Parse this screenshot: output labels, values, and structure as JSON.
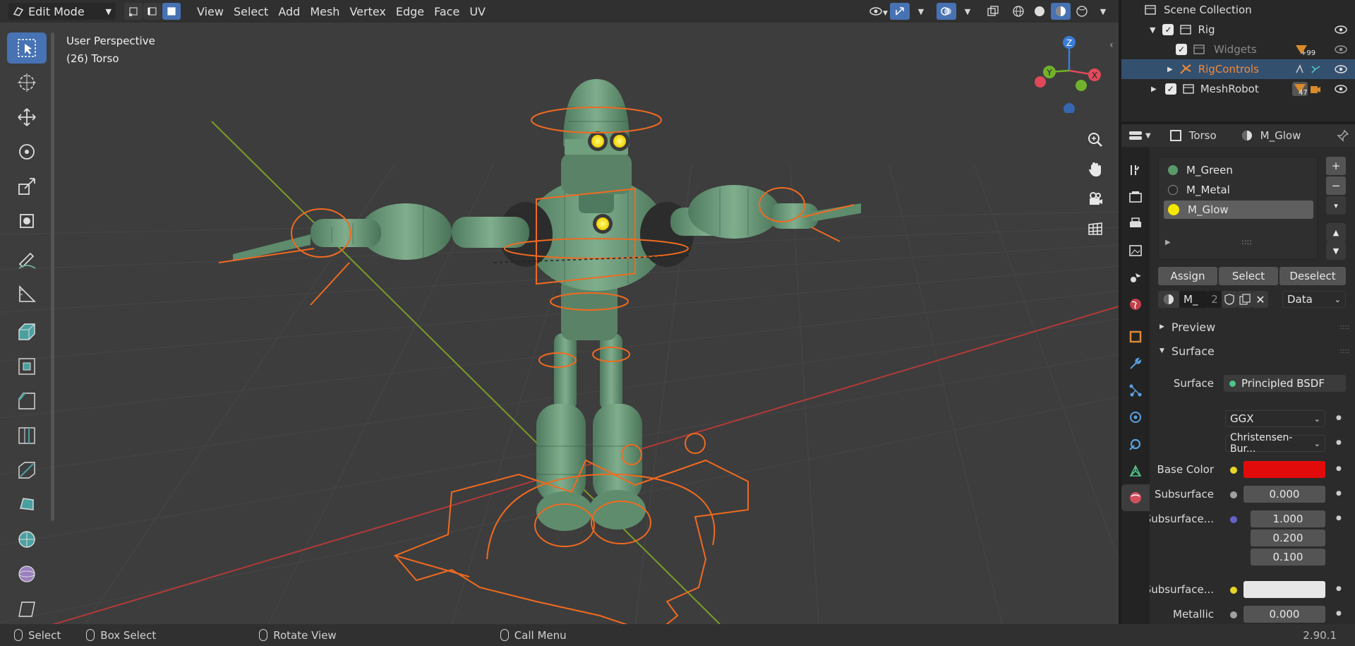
{
  "header": {
    "mode": "Edit Mode",
    "menus": [
      "View",
      "Select",
      "Add",
      "Mesh",
      "Vertex",
      "Edge",
      "Face",
      "UV"
    ]
  },
  "viewport": {
    "perspective": "User Perspective",
    "object": "(26) Torso",
    "gizmo_axes": {
      "x": "X",
      "y": "Y",
      "z": "Z"
    }
  },
  "outliner": {
    "scene_collection": "Scene Collection",
    "items": [
      {
        "name": "Rig",
        "badge": ""
      },
      {
        "name": "Widgets",
        "badge": "+99"
      },
      {
        "name": "RigControls",
        "badge": ""
      },
      {
        "name": "MeshRobot",
        "badge": "47"
      }
    ]
  },
  "properties": {
    "object_name": "Torso",
    "material_name": "M_Glow",
    "slots": [
      "M_Green",
      "M_Metal",
      "M_Glow"
    ],
    "assign": "Assign",
    "select": "Select",
    "deselect": "Deselect",
    "mat_field": "M_",
    "users": "2",
    "link": "Data",
    "preview": "Preview",
    "surface_panel": "Surface",
    "surface_label": "Surface",
    "surface_value": "Principled BSDF",
    "distribution": "GGX",
    "subsurface_method": "Christensen-Bur...",
    "base_color_label": "Base Color",
    "subsurface_label": "Subsurface",
    "subsurface_value": "0.000",
    "subsurface_radius_label": "Subsurface...",
    "radius": [
      "1.000",
      "0.200",
      "0.100"
    ],
    "subsurface_color_label": "Subsurface...",
    "metallic_label": "Metallic",
    "metallic_value": "0.000"
  },
  "colors": {
    "accent": "#4772b3",
    "base_color": "#e20b0b",
    "rig": "#f06a20",
    "robot": "#6f9f7d"
  },
  "statusbar": {
    "select": "Select",
    "box_select": "Box Select",
    "rotate_view": "Rotate View",
    "call_menu": "Call Menu",
    "version": "2.90.1"
  }
}
